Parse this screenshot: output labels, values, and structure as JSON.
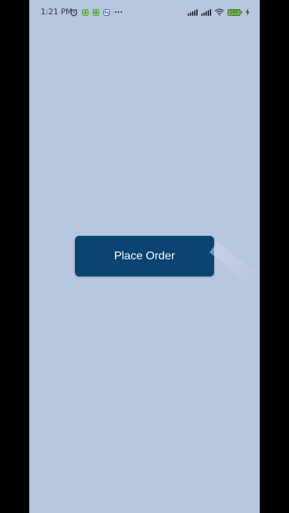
{
  "status_bar": {
    "time": "1:21 PM",
    "battery_level": "100",
    "left_icons": [
      "alarm-icon",
      "app-notification-icon",
      "app-notification-icon",
      "app-notification-icon",
      "more-dots-icon"
    ],
    "right_icons": [
      "signal-icon",
      "signal-icon",
      "wifi-icon",
      "battery-icon",
      "charging-icon"
    ]
  },
  "main": {
    "place_order_label": "Place Order"
  },
  "colors": {
    "background": "#b7c5de",
    "button": "#0a4470",
    "button_text": "#ffffff",
    "frame": "#000000"
  }
}
